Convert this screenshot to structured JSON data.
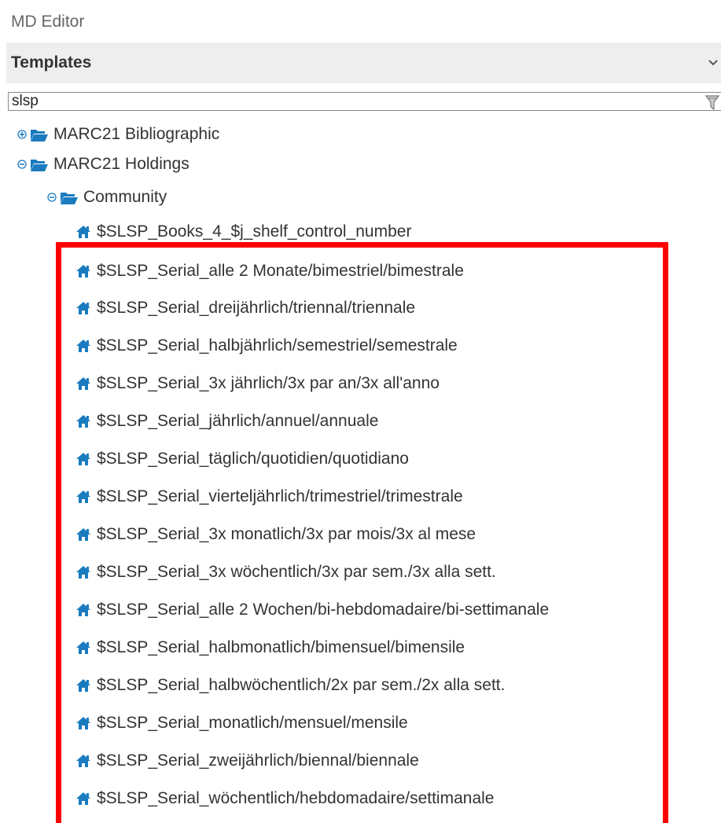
{
  "app": {
    "title": "MD Editor"
  },
  "section": {
    "title": "Templates"
  },
  "search": {
    "value": "slsp"
  },
  "icons": {
    "folder_color": "#1a7bbf",
    "home_color": "#1a7bbf",
    "highlight_color": "#ff0000"
  },
  "tree": {
    "nodes": [
      {
        "label": "MARC21 Bibliographic",
        "type": "folder",
        "state": "collapsed"
      },
      {
        "label": "MARC21 Holdings",
        "type": "folder",
        "state": "expanded"
      },
      {
        "label": "Community",
        "type": "folder",
        "state": "expanded"
      }
    ],
    "templates": [
      "$SLSP_Books_4_$j_shelf_control_number",
      "$SLSP_Serial_alle 2 Monate/bimestriel/bimestrale",
      "$SLSP_Serial_dreijährlich/triennal/triennale",
      "$SLSP_Serial_halbjährlich/semestriel/semestrale",
      "$SLSP_Serial_3x jährlich/3x par an/3x all'anno",
      "$SLSP_Serial_jährlich/annuel/annuale",
      "$SLSP_Serial_täglich/quotidien/quotidiano",
      "$SLSP_Serial_vierteljährlich/trimestriel/trimestrale",
      "$SLSP_Serial_3x monatlich/3x par mois/3x al mese",
      "$SLSP_Serial_3x wöchentlich/3x par sem./3x alla sett.",
      "$SLSP_Serial_alle 2 Wochen/bi-hebdomadaire/bi-settimanale",
      "$SLSP_Serial_halbmonatlich/bimensuel/bimensile",
      "$SLSP_Serial_halbwöchentlich/2x par sem./2x alla sett.",
      "$SLSP_Serial_monatlich/mensuel/mensile",
      "$SLSP_Serial_zweijährlich/biennal/biennale",
      "$SLSP_Serial_wöchentlich/hebdomadaire/settimanale"
    ]
  }
}
